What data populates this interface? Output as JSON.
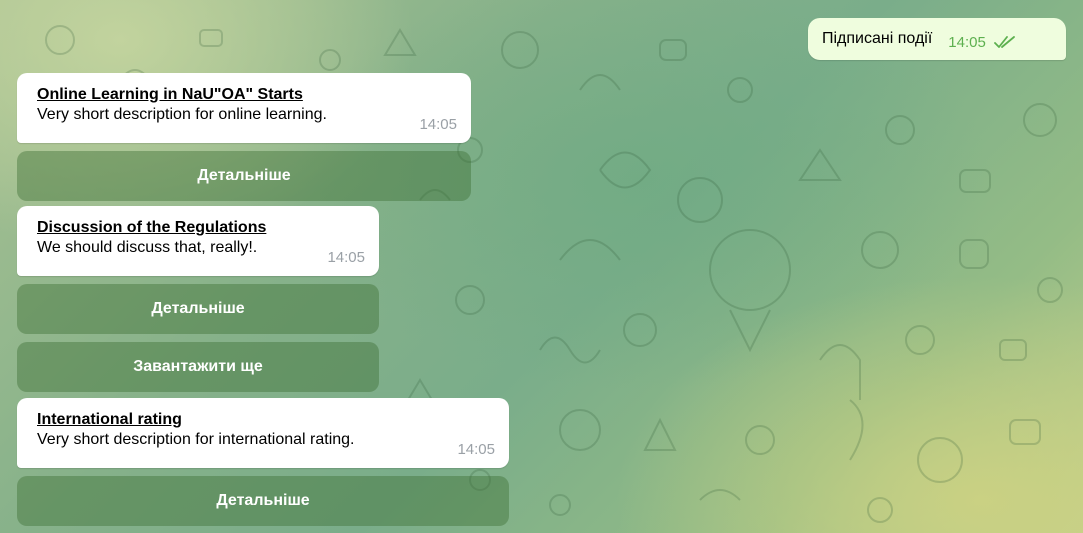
{
  "outgoing": {
    "text": "Підписані події",
    "time": "14:05",
    "status_icon": "double-check-icon"
  },
  "messages": [
    {
      "title": "Online Learning in NaU\"OA\" Starts",
      "description": "Very short description for online learning.",
      "time": "14:05",
      "buttons": [
        "Детальніше"
      ]
    },
    {
      "title": "Discussion of the Regulations",
      "description": "We should discuss that, really!.",
      "time": "14:05",
      "buttons": [
        "Детальніше",
        "Завантажити ще"
      ]
    },
    {
      "title": "International rating",
      "description": "Very short description for international rating.",
      "time": "14:05",
      "buttons": [
        "Детальніше"
      ]
    }
  ],
  "colors": {
    "outgoing_bubble": "#effdde",
    "incoming_bubble": "#ffffff",
    "read_check": "#5db04f",
    "inline_button": "rgba(60,110,50,0.42)"
  }
}
